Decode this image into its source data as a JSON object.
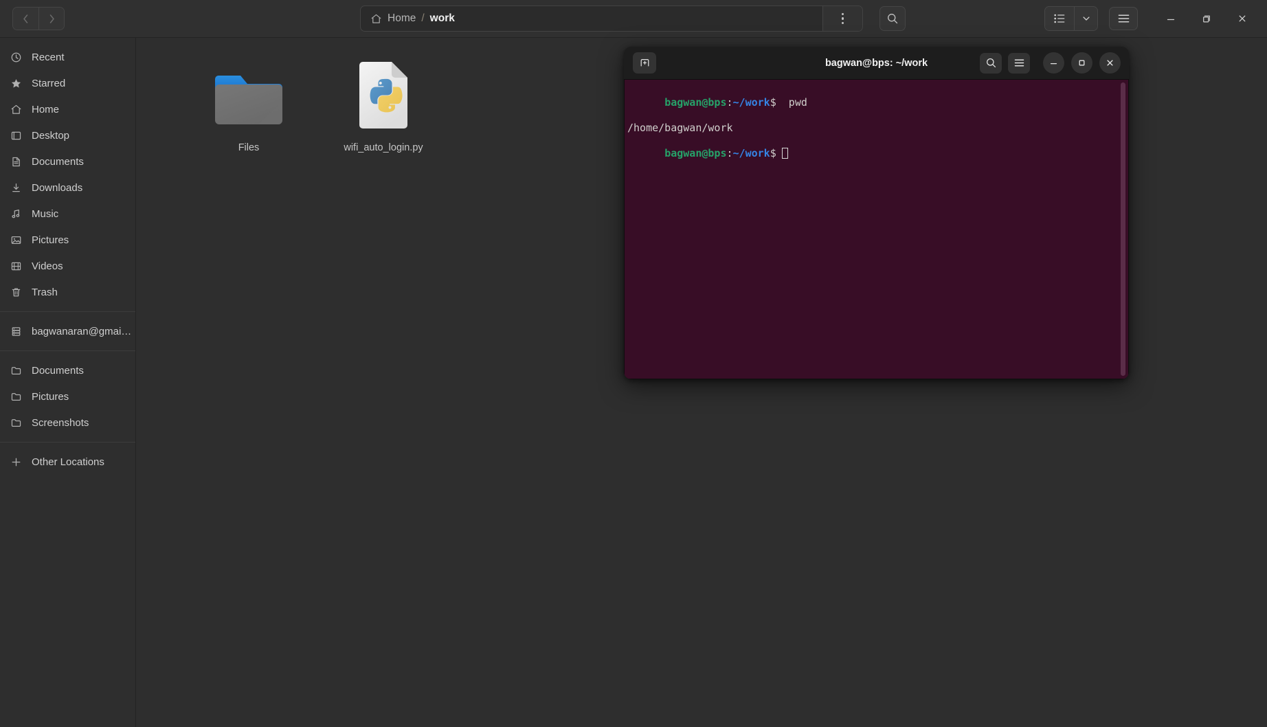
{
  "file_manager": {
    "nav": {
      "back_label": "Back",
      "forward_label": "Forward"
    },
    "pathbar": {
      "home_label": "Home",
      "separator": "/",
      "current_label": "work"
    },
    "buttons": {
      "kebab_label": "Path options",
      "search_label": "Search",
      "list_view_label": "List view",
      "view_options_label": "View options",
      "menu_label": "Main menu",
      "minimize_label": "Minimize",
      "maximize_label": "Maximize",
      "close_label": "Close"
    },
    "sidebar": {
      "groups": [
        {
          "items": [
            {
              "label": "Recent",
              "icon": "clock-icon"
            },
            {
              "label": "Starred",
              "icon": "star-icon"
            },
            {
              "label": "Home",
              "icon": "home-icon"
            },
            {
              "label": "Desktop",
              "icon": "desktop-icon"
            },
            {
              "label": "Documents",
              "icon": "document-icon"
            },
            {
              "label": "Downloads",
              "icon": "download-icon"
            },
            {
              "label": "Music",
              "icon": "music-icon"
            },
            {
              "label": "Pictures",
              "icon": "image-icon"
            },
            {
              "label": "Videos",
              "icon": "video-icon"
            },
            {
              "label": "Trash",
              "icon": "trash-icon"
            }
          ]
        },
        {
          "items": [
            {
              "label": "bagwanaran@gmai…",
              "icon": "server-icon"
            }
          ]
        },
        {
          "items": [
            {
              "label": "Documents",
              "icon": "folder-icon"
            },
            {
              "label": "Pictures",
              "icon": "folder-icon"
            },
            {
              "label": "Screenshots",
              "icon": "folder-icon"
            }
          ]
        },
        {
          "items": [
            {
              "label": "Other Locations",
              "icon": "plus-icon"
            }
          ]
        }
      ]
    },
    "files": [
      {
        "name": "Files",
        "type": "folder"
      },
      {
        "name": "wifi_auto_login.py",
        "type": "python-file"
      }
    ]
  },
  "terminal": {
    "title": "bagwan@bps: ~/work",
    "buttons": {
      "new_tab_label": "New tab",
      "search_label": "Search",
      "menu_label": "Menu",
      "minimize_label": "Minimize",
      "maximize_label": "Restore",
      "close_label": "Close"
    },
    "prompt": {
      "user_host": "bagwan@bps",
      "colon": ":",
      "path": "~/work",
      "dollar": "$"
    },
    "lines": [
      {
        "kind": "prompt",
        "command": "pwd"
      },
      {
        "kind": "output",
        "text": "/home/bagwan/work"
      },
      {
        "kind": "prompt",
        "command": ""
      }
    ],
    "colors": {
      "background": "#380d26",
      "user": "#26a269",
      "path": "#3584e4",
      "text": "#d0cfcc"
    }
  }
}
